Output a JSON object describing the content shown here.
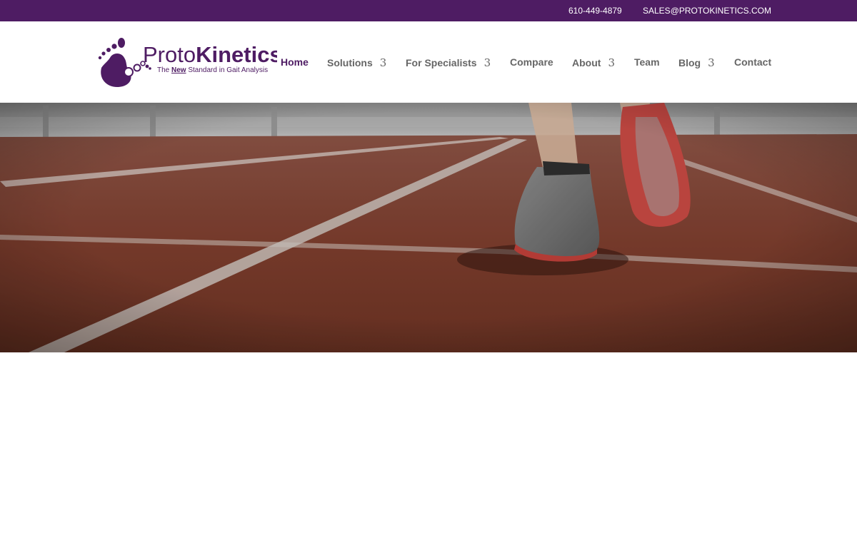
{
  "topbar": {
    "phone": "610-449-4879",
    "email": "SALES@PROTOKINETICS.COM"
  },
  "logo": {
    "wordmark_part1": "Proto",
    "wordmark_part2": "Kinetics",
    "tagline_part1": "The ",
    "tagline_emphasis": "New",
    "tagline_part2": " Standard in Gait Analysis",
    "icon": "footprint-icon"
  },
  "nav": {
    "items": [
      {
        "label": "Home",
        "active": true,
        "has_dropdown": false
      },
      {
        "label": "Solutions",
        "has_dropdown": true,
        "chevron": "3"
      },
      {
        "label": "For Specialists",
        "has_dropdown": true,
        "chevron": "3"
      },
      {
        "label": "Compare",
        "has_dropdown": false
      },
      {
        "label": "About",
        "has_dropdown": true,
        "chevron": "3"
      },
      {
        "label": "Team",
        "has_dropdown": false
      },
      {
        "label": "Blog",
        "has_dropdown": true,
        "chevron": "3"
      },
      {
        "label": "Contact",
        "has_dropdown": false
      }
    ]
  },
  "hero": {
    "image": "running-track-shoe-photo"
  },
  "colors": {
    "brand_purple": "#4e1c63",
    "nav_text": "#666666",
    "track": "#8a4a38"
  }
}
